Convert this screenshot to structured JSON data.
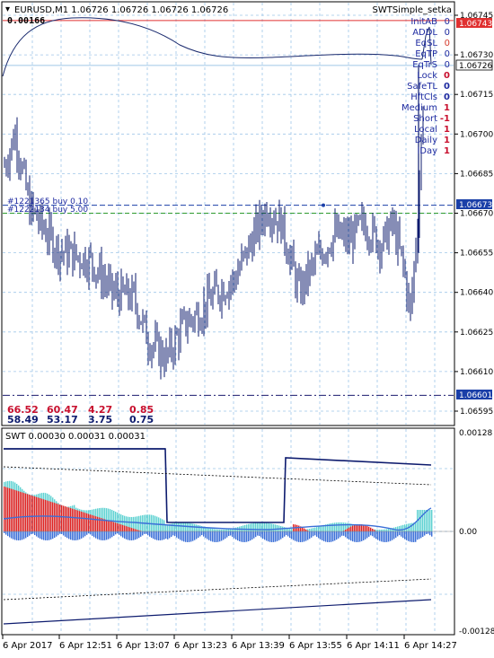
{
  "main_chart": {
    "symbol_ohlc": "EURUSD,M1  1.06726 1.06726 1.06726 1.06726",
    "indicator_name": "SWTSimple_setka",
    "top_left_value": "0.00166",
    "price_axis_labels": [
      "1.06745",
      "1.06730",
      "1.06715",
      "1.06700",
      "1.06685",
      "1.06670",
      "1.06655",
      "1.06640",
      "1.06625",
      "1.06610",
      "1.06595"
    ],
    "price_range": [
      1.065905,
      1.0675
    ],
    "current_price": "1.06726",
    "red_level_price": "1.06743",
    "blue_level_price": "1.06673",
    "bottom_level_price": "1.06601",
    "orders": [
      "#1221365 buy 0.10",
      "#1222134 buy 5.00"
    ],
    "info_rows": [
      {
        "label": "InitAB",
        "value": "0",
        "color": "#1e2aa0"
      },
      {
        "label": "ADDL",
        "value": "0",
        "color": "#1e2aa0"
      },
      {
        "label": "EqSL",
        "value": "0",
        "color": "#d63c2e"
      },
      {
        "label": "EqTP",
        "value": "0",
        "color": "#1e2aa0"
      },
      {
        "label": "EqTrS",
        "value": "0",
        "color": "#1e2aa0"
      },
      {
        "label": "Lock",
        "value": "0",
        "color": "#c8102e"
      },
      {
        "label": "SafeTL",
        "value": "0",
        "color": "#1e2aa0"
      },
      {
        "label": "HftCls",
        "value": "0",
        "color": "#1e2aa0"
      },
      {
        "label": "Medium",
        "value": "1",
        "color": "#c8102e"
      },
      {
        "label": "Short",
        "value": "-1",
        "color": "#c8102e"
      },
      {
        "label": "Local",
        "value": "1",
        "color": "#c8102e"
      },
      {
        "label": "Daily",
        "value": "1",
        "color": "#c8102e"
      },
      {
        "label": "lDay",
        "value": "1",
        "color": "#c8102e"
      }
    ],
    "stats_row1": [
      "66.52",
      "60.47",
      "4.27",
      "0.85"
    ],
    "stats_row2": [
      "58.49",
      "53.17",
      "3.75",
      "0.75"
    ]
  },
  "sub_chart": {
    "title": "SWT 0.00030 0.00031 0.00031",
    "axis_labels": [
      "0.00128",
      "0.00",
      "-0.00128"
    ]
  },
  "time_axis": [
    "6 Apr 2017",
    "6 Apr 12:51",
    "6 Apr 13:07",
    "6 Apr 13:23",
    "6 Apr 13:39",
    "6 Apr 13:55",
    "6 Apr 14:11",
    "6 Apr 14:27"
  ],
  "colors": {
    "candle": "#0d1b6e",
    "up_hist": "#5ed2d2",
    "down_hist": "#e02020",
    "blue_hist": "#3b6fd8",
    "level_red": "#e03030",
    "level_blue": "#1a3fa8",
    "level_green": "#2e9a2e",
    "grid": "#9fc6e8"
  }
}
